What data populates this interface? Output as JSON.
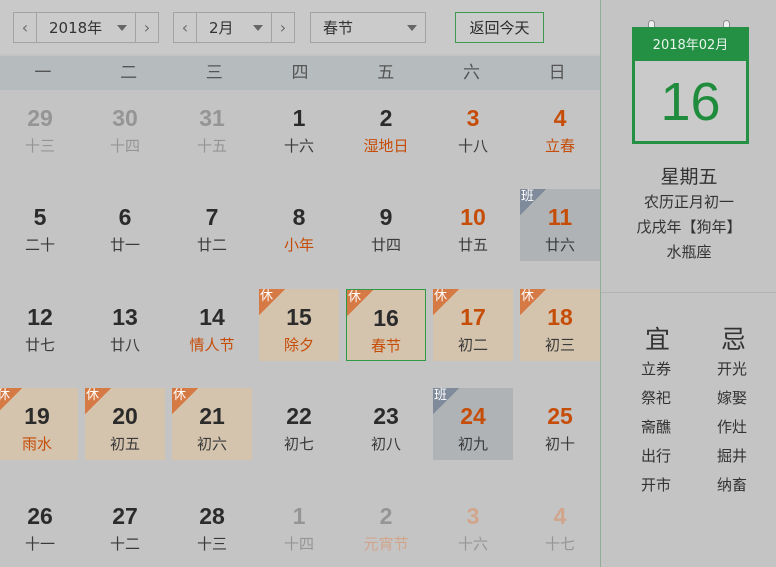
{
  "toolbar": {
    "year": "2018年",
    "month": "2月",
    "holiday": "春节",
    "today_button": "返回今天",
    "prev_glyph": "‹",
    "next_glyph": "›"
  },
  "weekdays": [
    "一",
    "二",
    "三",
    "四",
    "五",
    "六",
    "日"
  ],
  "weeks": [
    [
      {
        "day": "29",
        "sub": "十三",
        "other": true
      },
      {
        "day": "30",
        "sub": "十四",
        "other": true
      },
      {
        "day": "31",
        "sub": "十五",
        "other": true
      },
      {
        "day": "1",
        "sub": "十六"
      },
      {
        "day": "2",
        "sub": "湿地日",
        "festival": true
      },
      {
        "day": "3",
        "sub": "十八",
        "weekend": true
      },
      {
        "day": "4",
        "sub": "立春",
        "weekend": true,
        "festival": true
      }
    ],
    [
      {
        "day": "5",
        "sub": "二十"
      },
      {
        "day": "6",
        "sub": "廿一"
      },
      {
        "day": "7",
        "sub": "廿二"
      },
      {
        "day": "8",
        "sub": "小年",
        "festival": true
      },
      {
        "day": "9",
        "sub": "廿四"
      },
      {
        "day": "10",
        "sub": "廿五",
        "weekend": true
      },
      {
        "day": "11",
        "sub": "廿六",
        "weekend": true,
        "badge": "班"
      }
    ],
    [
      {
        "day": "12",
        "sub": "廿七"
      },
      {
        "day": "13",
        "sub": "廿八"
      },
      {
        "day": "14",
        "sub": "情人节",
        "festival": true
      },
      {
        "day": "15",
        "sub": "除夕",
        "festival": true,
        "badge": "休"
      },
      {
        "day": "16",
        "sub": "春节",
        "festival": true,
        "badge": "休",
        "selected": true
      },
      {
        "day": "17",
        "sub": "初二",
        "weekend": true,
        "badge": "休"
      },
      {
        "day": "18",
        "sub": "初三",
        "weekend": true,
        "badge": "休"
      }
    ],
    [
      {
        "day": "19",
        "sub": "雨水",
        "festival": true,
        "badge": "休"
      },
      {
        "day": "20",
        "sub": "初五",
        "badge": "休"
      },
      {
        "day": "21",
        "sub": "初六",
        "badge": "休"
      },
      {
        "day": "22",
        "sub": "初七"
      },
      {
        "day": "23",
        "sub": "初八"
      },
      {
        "day": "24",
        "sub": "初九",
        "weekend": true,
        "badge": "班"
      },
      {
        "day": "25",
        "sub": "初十",
        "weekend": true
      }
    ],
    [
      {
        "day": "26",
        "sub": "十一"
      },
      {
        "day": "27",
        "sub": "十二"
      },
      {
        "day": "28",
        "sub": "十三"
      },
      {
        "day": "1",
        "sub": "十四",
        "other": true
      },
      {
        "day": "2",
        "sub": "元宵节",
        "other": true,
        "festival": true
      },
      {
        "day": "3",
        "sub": "十六",
        "other": true,
        "weekend": true
      },
      {
        "day": "4",
        "sub": "十七",
        "other": true,
        "weekend": true
      }
    ]
  ],
  "panel": {
    "header": "2018年02月",
    "day": "16",
    "weekday": "星期五",
    "lunar": "农历正月初一",
    "ganzhi": "戊戌年【狗年】",
    "zodiac": "水瓶座",
    "yi_title": "宜",
    "ji_title": "忌",
    "yi": [
      "立券",
      "祭祀",
      "斋醮",
      "出行",
      "开市"
    ],
    "ji": [
      "开光",
      "嫁娶",
      "作灶",
      "掘井",
      "纳畜"
    ]
  },
  "colors": {
    "accent_green": "#239044",
    "festival_orange": "#c64d08",
    "holiday_bg": "#d4c3ad",
    "workday_bg": "#b0b3b6"
  }
}
